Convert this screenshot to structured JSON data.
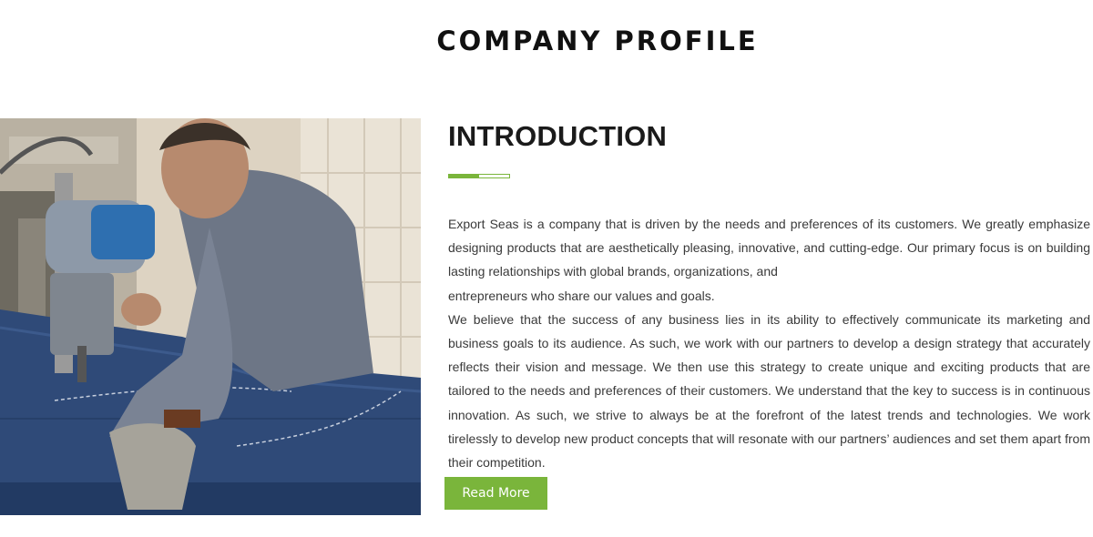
{
  "page": {
    "title": "COMPANY PROFILE"
  },
  "intro": {
    "heading": "INTRODUCTION",
    "accent_color": "#7ab53b",
    "paragraph1_part1": "Export Seas is a company that is driven by the needs and preferences of its customers. We greatly emphasize designing products that are aesthetically pleasing, innovative, and cutting-edge. Our primary focus is on building lasting relationships with global brands, organizations, and",
    "paragraph1_part2": "entrepreneurs who share our values and goals.",
    "paragraph2": "We believe that the success of any business lies in its ability to effectively communicate its marketing and business goals to its audience. As such, we work with our partners to develop a design strategy that accurately reflects their vision and message. We then use this strategy to create unique and exciting products that are tailored to the needs and preferences of their customers. We understand that the key to success is in continuous innovation. As such, we strive to always be at the forefront of the latest trends and technologies. We work tirelessly to develop new product concepts that will resonate with our partners’ audiences and set them apart from their competition.",
    "read_more_label": "Read More"
  }
}
